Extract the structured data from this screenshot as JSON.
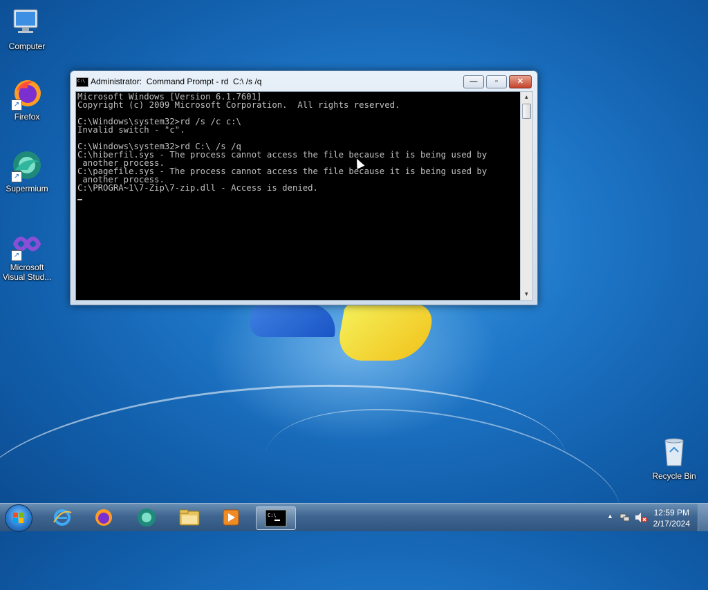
{
  "desktop": {
    "icons": [
      {
        "label": "Computer",
        "icon": "computer-icon"
      },
      {
        "label": "Firefox",
        "icon": "firefox-icon"
      },
      {
        "label": "Supermium",
        "icon": "supermium-icon"
      },
      {
        "label": "Microsoft Visual Stud...",
        "icon": "visual-studio-icon"
      },
      {
        "label": "Recycle Bin",
        "icon": "recycle-bin-icon"
      }
    ]
  },
  "window": {
    "title": "Administrator:  Command Prompt - rd  C:\\ /s /q",
    "buttons": {
      "minimize": "minimize",
      "maximize": "maximize",
      "close": "close"
    },
    "console_lines": [
      "Microsoft Windows [Version 6.1.7601]",
      "Copyright (c) 2009 Microsoft Corporation.  All rights reserved.",
      "",
      "C:\\Windows\\system32>rd /s /c c:\\",
      "Invalid switch - \"c\".",
      "",
      "C:\\Windows\\system32>rd C:\\ /s /q",
      "C:\\hiberfil.sys - The process cannot access the file because it is being used by",
      " another process.",
      "C:\\pagefile.sys - The process cannot access the file because it is being used by",
      " another process.",
      "C:\\PROGRA~1\\7-Zip\\7-zip.dll - Access is denied."
    ]
  },
  "taskbar": {
    "items": [
      {
        "name": "internet-explorer",
        "icon": "internet-explorer-icon"
      },
      {
        "name": "firefox",
        "icon": "firefox-icon"
      },
      {
        "name": "supermium",
        "icon": "supermium-icon"
      },
      {
        "name": "file-explorer",
        "icon": "folder-icon"
      },
      {
        "name": "media-player",
        "icon": "media-player-icon"
      },
      {
        "name": "command-prompt",
        "icon": "cmd-icon",
        "active": true
      }
    ],
    "clock": {
      "time": "12:59 PM",
      "date": "2/17/2024"
    }
  },
  "colors": {
    "console_bg": "#000000",
    "console_fg": "#c0c0c0",
    "taskbar": "#3f6690",
    "desktop": "#1f77c8"
  }
}
